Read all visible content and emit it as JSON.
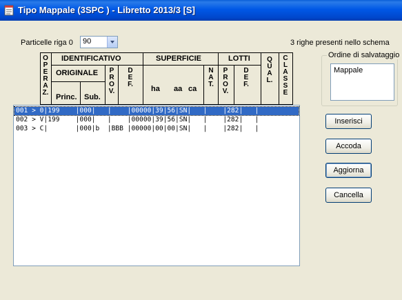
{
  "window": {
    "title": "Tipo Mappale (3SPC ) - Libretto 2013/3 [S]"
  },
  "form": {
    "row_label": "Particelle riga 0",
    "row_value": "90",
    "rows_present": "3 righe presenti nello schema"
  },
  "save_order": {
    "group_title": "Ordine di salvataggio",
    "items": [
      "Mappale"
    ]
  },
  "header": {
    "operaz": [
      "O",
      "P",
      "E",
      "R",
      "A",
      "Z."
    ],
    "identificativo": "IDENTIFICATIVO",
    "originale": "ORIGINALE",
    "princ": "Princ.",
    "sub": "Sub.",
    "prov": [
      "P",
      "R",
      "O",
      "V."
    ],
    "def": [
      "D",
      "E",
      "F."
    ],
    "superficie": "SUPERFICIE",
    "ha": "ha",
    "aa": "aa",
    "ca": "ca",
    "nat": [
      "N",
      "A",
      "T."
    ],
    "lotti": "LOTTI",
    "lotti_prov": [
      "P",
      "R",
      "O",
      "V."
    ],
    "lotti_def": [
      "D",
      "E",
      "F."
    ],
    "qual": [
      "Q",
      "U",
      "A",
      "L."
    ],
    "classe": [
      "C",
      "L",
      "A",
      "S",
      "S",
      "E"
    ]
  },
  "rows": [
    "001 > 0|199    |000|   |    |00000|39|56|SN|   |    |282|   |",
    "002 > V|199    |000|   |    |00000|39|56|SN|   |    |282|   |",
    "003 > C|       |000|b  |BBB |00000|00|00|SN|   |    |282|   |"
  ],
  "buttons": {
    "inserisci": "Inserisci",
    "accoda": "Accoda",
    "aggiorna": "Aggiorna",
    "cancella": "Cancella"
  }
}
